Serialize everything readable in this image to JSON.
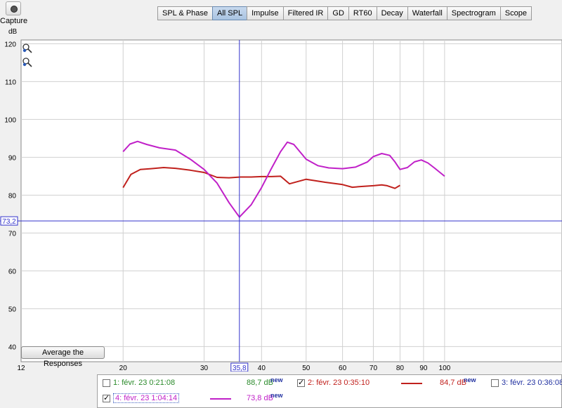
{
  "toolbar": {
    "capture_label": "Capture",
    "tabs": [
      "SPL & Phase",
      "All SPL",
      "Impulse",
      "Filtered IR",
      "GD",
      "RT60",
      "Decay",
      "Waterfall",
      "Spectrogram",
      "Scope"
    ],
    "active_tab": "All SPL"
  },
  "y_unit": "dB",
  "average_button_label": "Average the Responses",
  "cursor": {
    "x_label": "35,8",
    "y_label": "73,2",
    "x": 35.8,
    "y": 73.2,
    "color": "#3333cc"
  },
  "chart_data": {
    "type": "line",
    "xscale": "log",
    "xlim": [
      12,
      180
    ],
    "ylim": [
      36,
      121
    ],
    "x_ticks": [
      12,
      20,
      30,
      40,
      50,
      60,
      70,
      80,
      90,
      100
    ],
    "x_tick_labels": [
      "12",
      "20",
      "30",
      "40",
      "50",
      "60",
      "70",
      "80",
      "90",
      "100"
    ],
    "y_ticks": [
      40,
      50,
      60,
      70,
      80,
      90,
      100,
      110,
      120
    ],
    "y_tick_labels": [
      "40",
      "50",
      "60",
      "70",
      "80",
      "90",
      "100",
      "110",
      "120"
    ],
    "grid": true,
    "series": [
      {
        "name": "2: févr. 23 0:35:10",
        "color": "#c0201c",
        "x": [
          20,
          20.8,
          21.8,
          23,
          24.5,
          26,
          28,
          30,
          32,
          34,
          36,
          38,
          40,
          42,
          44,
          46,
          50,
          55,
          60,
          63,
          66,
          70,
          73,
          75,
          78,
          80
        ],
        "y": [
          82,
          85.5,
          86.8,
          87,
          87.3,
          87.1,
          86.6,
          86,
          84.7,
          84.6,
          84.8,
          84.8,
          84.9,
          84.9,
          85,
          83,
          84.2,
          83.4,
          82.8,
          82.1,
          82.3,
          82.5,
          82.7,
          82.5,
          81.8,
          82.6
        ]
      },
      {
        "name": "4: févr. 23 1:04:14",
        "color": "#c020c8",
        "x": [
          20,
          20.7,
          21.5,
          22.5,
          24,
          26,
          28,
          30,
          32,
          34,
          35.8,
          38,
          40,
          42,
          44,
          45.5,
          47,
          50,
          53,
          56,
          60,
          64,
          68,
          70,
          73,
          76,
          78,
          80,
          83,
          86,
          89,
          92,
          95,
          100
        ],
        "y": [
          91.5,
          93.5,
          94.2,
          93.4,
          92.5,
          91.9,
          89.5,
          86.8,
          83.2,
          78,
          74.2,
          77.5,
          82,
          87,
          91.5,
          94,
          93.4,
          89.5,
          87.8,
          87.2,
          87,
          87.4,
          88.8,
          90.2,
          91,
          90.5,
          88.8,
          86.8,
          87.3,
          88.8,
          89.3,
          88.5,
          87.2,
          85
        ]
      }
    ]
  },
  "legend": [
    {
      "label": "1: févr. 23 0:21:08",
      "value": "88,7 dB",
      "badge": "new",
      "checked": false,
      "color": "#2a8a2a",
      "show_line": false
    },
    {
      "label": "2: févr. 23 0:35:10",
      "value": "84,7 dB",
      "badge": "new",
      "checked": true,
      "color": "#c0201c",
      "show_line": true
    },
    {
      "label": "3: févr. 23 0:36:08",
      "value": "",
      "badge": "",
      "checked": false,
      "color": "#2030a0",
      "show_line": false
    },
    {
      "label": "4: févr. 23 1:04:14",
      "value": "73,8 dB",
      "badge": "new",
      "checked": true,
      "color": "#c020c8",
      "show_line": true
    }
  ]
}
